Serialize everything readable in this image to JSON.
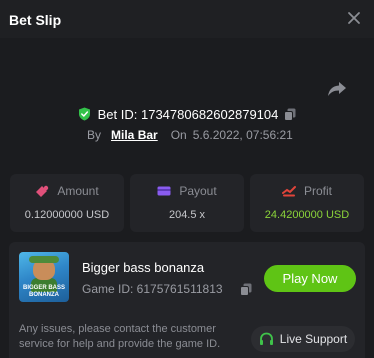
{
  "header": {
    "title": "Bet Slip"
  },
  "bet": {
    "id_label": "Bet ID: 1734780682602879104",
    "by_label": "By",
    "user": "Mila Bar",
    "on_label": "On",
    "date": "5.6.2022, 07:56:21"
  },
  "stats": {
    "amount": {
      "label": "Amount",
      "value": "0.12000000 USD"
    },
    "payout": {
      "label": "Payout",
      "value": "204.5 x"
    },
    "profit": {
      "label": "Profit",
      "value": "24.4200000 USD"
    }
  },
  "game": {
    "thumb_text_line1": "BIGGER BASS",
    "thumb_text_line2": "BONANZA",
    "name": "Bigger bass bonanza",
    "id_label": "Game ID: 6175761511813",
    "play_label": "Play Now"
  },
  "help": {
    "text": "Any issues, please contact the customer service for help and provide the game ID.",
    "support_label": "Live Support"
  },
  "colors": {
    "accent_green": "#5fc415",
    "profit_green": "#8bd43a",
    "amount_icon": "#e0507a",
    "payout_icon": "#8a5cf0",
    "profit_icon": "#e0443a"
  },
  "icons": [
    "close-icon",
    "share-icon",
    "shield-check-icon",
    "copy-icon",
    "amount-icon",
    "payout-icon",
    "profit-icon",
    "headset-icon"
  ]
}
